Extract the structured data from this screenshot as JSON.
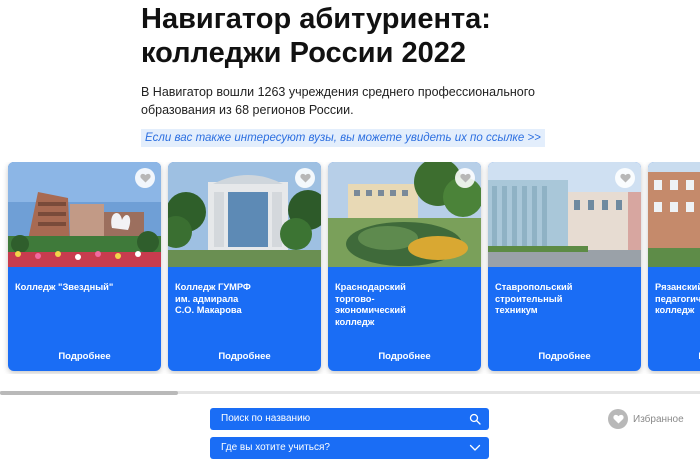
{
  "header": {
    "title_line1": "Навигатор абитуриента:",
    "title_line2": "колледжи России 2022"
  },
  "intro": {
    "line1": "В Навигатор вошли 1263 учреждения среднего профессионального",
    "line2": "образования из 68 регионов России."
  },
  "vuz_link": "Если вас также интересуют вузы, вы можете увидеть их по ссылке >>",
  "cards": [
    {
      "name_lines": [
        "Колледж \"Звездный\""
      ],
      "more": "Подробнее"
    },
    {
      "name_lines": [
        "Колледж ГУМРФ",
        "им. адмирала",
        "С.О. Макарова"
      ],
      "more": "Подробнее"
    },
    {
      "name_lines": [
        "Краснодарский",
        "торгово-",
        "экономический",
        "колледж"
      ],
      "more": "Подробнее"
    },
    {
      "name_lines": [
        "Ставропольский",
        "строительный",
        "техникум"
      ],
      "more": "Подробнее"
    },
    {
      "name_lines": [
        "Рязанский",
        "педагогический",
        "колледж"
      ],
      "more": "Подробнее"
    }
  ],
  "filters": {
    "search_placeholder": "Поиск по названию",
    "region_label": "Где вы хотите учиться?"
  },
  "favorites_label": "Избранное",
  "colors": {
    "accent": "#1a6df5",
    "link_bg": "#e3eefc",
    "link_text": "#2c6fe0"
  },
  "icons": {
    "favorite": "heart-icon",
    "search": "search-icon",
    "dropdown": "chevron-down-icon"
  }
}
